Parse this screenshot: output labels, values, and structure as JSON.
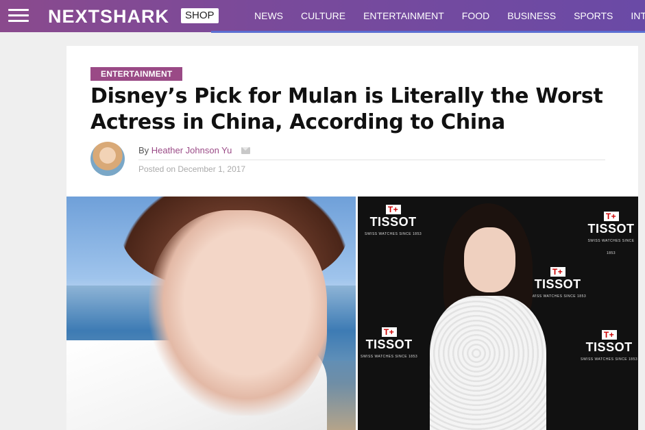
{
  "header": {
    "logo": "NEXTSHARK",
    "shop_label": "SHOP",
    "nav": [
      "NEWS",
      "CULTURE",
      "ENTERTAINMENT",
      "FOOD",
      "BUSINESS",
      "SPORTS",
      "INT"
    ]
  },
  "article": {
    "category": "ENTERTAINMENT",
    "title": "Disney’s Pick for Mulan is Literally the Worst Actress in China, According to China",
    "by_prefix": "By",
    "author": "Heather Johnson Yu",
    "posted": "Posted on December 1, 2017"
  },
  "images": {
    "brand_text": "TISSOT",
    "brand_mark": "T+",
    "brand_sub": "SWISS WATCHES SINCE 1853"
  },
  "colors": {
    "header_bg": "#7a4a9a",
    "accent": "#9a4a86",
    "nav_underline": "#5b6fd2"
  }
}
